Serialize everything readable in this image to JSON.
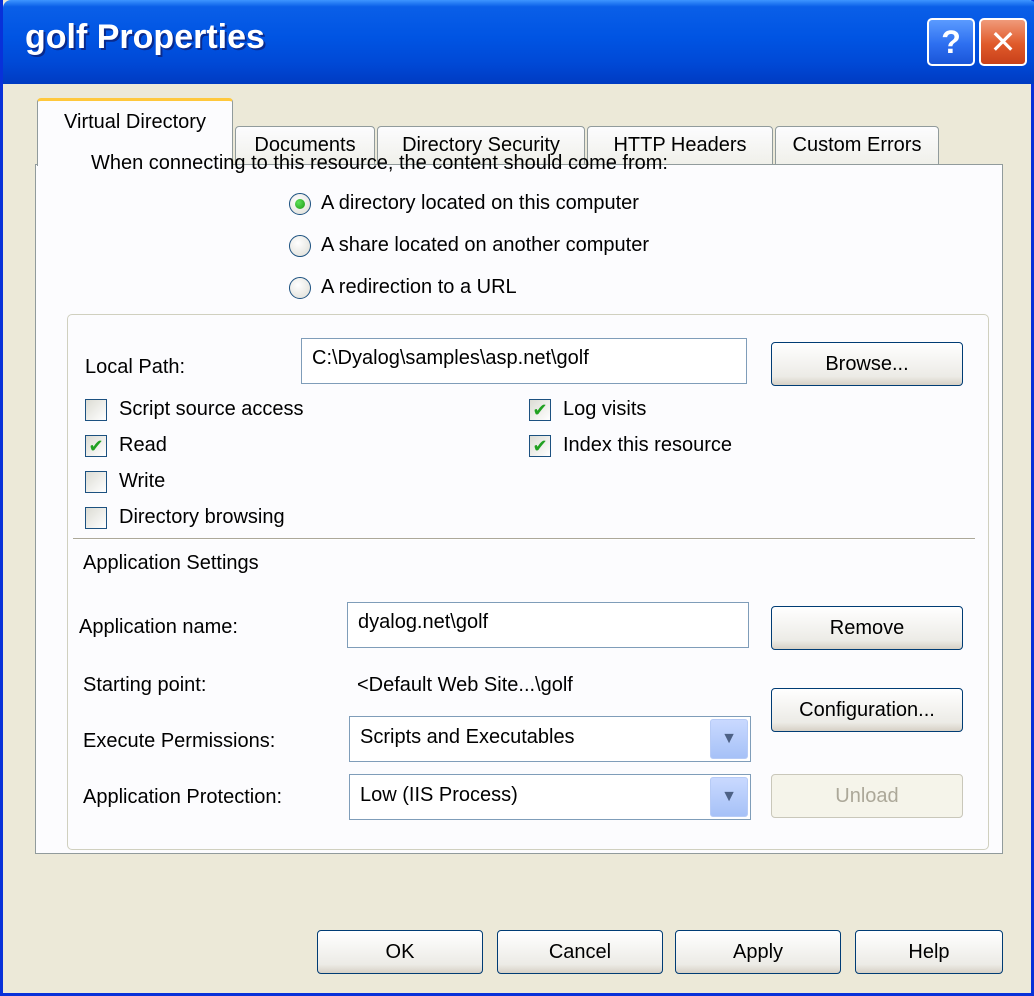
{
  "window": {
    "title": "golf Properties",
    "help_glyph": "?",
    "close_glyph": "✕"
  },
  "tabs": [
    {
      "label": "Virtual Directory",
      "active": true
    },
    {
      "label": "Documents",
      "active": false
    },
    {
      "label": "Directory Security",
      "active": false
    },
    {
      "label": "HTTP Headers",
      "active": false
    },
    {
      "label": "Custom Errors",
      "active": false
    }
  ],
  "content_source": {
    "prompt": "When connecting to this resource, the content should come from:",
    "options": [
      {
        "label": "A directory located on this computer",
        "selected": true
      },
      {
        "label": "A share located on another computer",
        "selected": false
      },
      {
        "label": "A redirection to a URL",
        "selected": false
      }
    ]
  },
  "local_path": {
    "label": "Local Path:",
    "value": "C:\\Dyalog\\samples\\asp.net\\golf",
    "browse_label": "Browse..."
  },
  "checkboxes": {
    "script_source_access": {
      "label": "Script source access",
      "checked": false
    },
    "read": {
      "label": "Read",
      "checked": true
    },
    "write": {
      "label": "Write",
      "checked": false
    },
    "directory_browsing": {
      "label": "Directory browsing",
      "checked": false
    },
    "log_visits": {
      "label": "Log visits",
      "checked": true
    },
    "index_resource": {
      "label": "Index this resource",
      "checked": true
    }
  },
  "app_settings": {
    "heading": "Application Settings",
    "name_label": "Application name:",
    "name_value": "dyalog.net\\golf",
    "remove_label": "Remove",
    "starting_point_label": "Starting point:",
    "starting_point_value": "<Default Web Site...\\golf",
    "configuration_label": "Configuration...",
    "execute_label": "Execute Permissions:",
    "execute_value": "Scripts and Executables",
    "protection_label": "Application Protection:",
    "protection_value": "Low (IIS Process)",
    "unload_label": "Unload"
  },
  "footer": {
    "ok_label": "OK",
    "cancel_label": "Cancel",
    "apply_label": "Apply",
    "help_label": "Help"
  },
  "icons": {
    "check": "✔",
    "dropdown": "▼"
  },
  "colors": {
    "titlebar": "#0054e3",
    "dialog_bg": "#ece9d8",
    "close_button": "#e05a2a",
    "active_tab_highlight": "#ffc83c",
    "check_green": "#21a121"
  }
}
